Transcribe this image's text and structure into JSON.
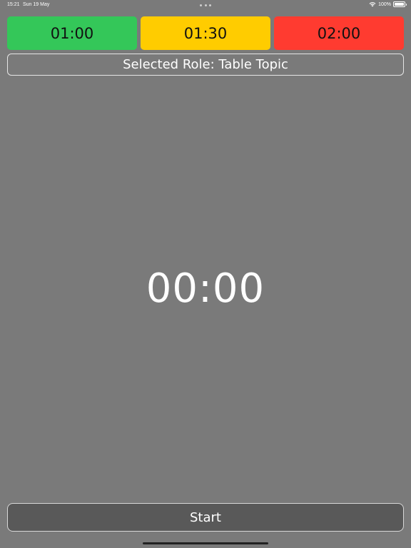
{
  "status_bar": {
    "time": "15:21",
    "date": "Sun 19 May",
    "battery": "100%",
    "battery_level": 1.0
  },
  "presets": [
    {
      "label": "01:00",
      "color": "#34c759"
    },
    {
      "label": "01:30",
      "color": "#ffcc00"
    },
    {
      "label": "02:00",
      "color": "#ff3b30"
    }
  ],
  "role": {
    "text": "Selected Role: Table Topic"
  },
  "timer": {
    "display": "00:00"
  },
  "controls": {
    "start_label": "Start"
  },
  "colors": {
    "background": "#7a7a7a",
    "start_button": "#595959"
  }
}
